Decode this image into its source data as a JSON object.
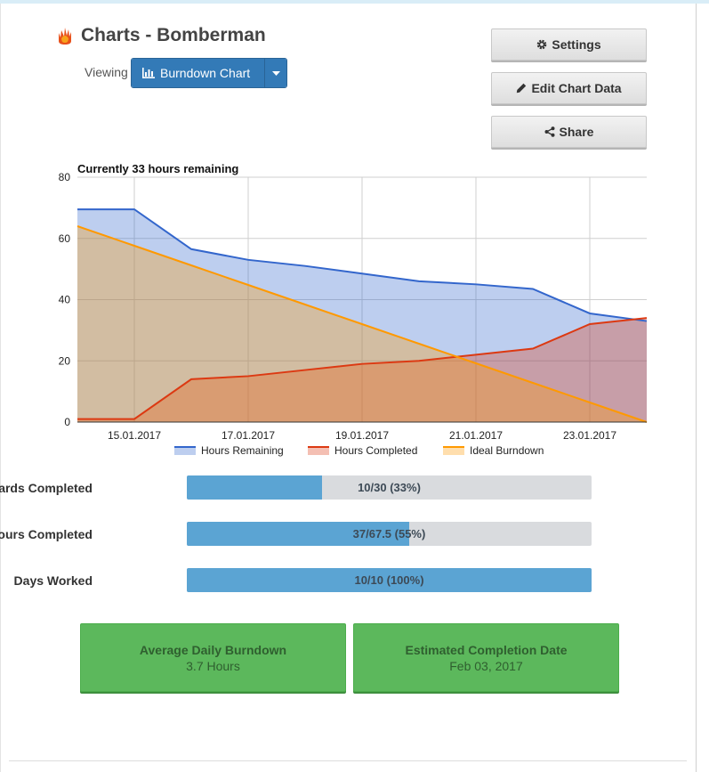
{
  "header": {
    "title": "Charts - Bomberman",
    "viewing_label": "Viewing",
    "view_selector": "Burndown Chart"
  },
  "actions": {
    "settings": "Settings",
    "edit": "Edit Chart Data",
    "share": "Share"
  },
  "colors": {
    "remaining": "#3366cc",
    "completed": "#dc3912",
    "ideal": "#ff9900",
    "progress": "#5ba4d3",
    "stat": "#5cb85c"
  },
  "chart_data": {
    "type": "area",
    "title": "Currently 33 hours remaining",
    "x": [
      "14.01.2017",
      "15.01.2017",
      "16.01.2017",
      "17.01.2017",
      "18.01.2017",
      "19.01.2017",
      "20.01.2017",
      "21.01.2017",
      "22.01.2017",
      "23.01.2017",
      "24.01.2017"
    ],
    "x_tick_labels": [
      "15.01.2017",
      "17.01.2017",
      "19.01.2017",
      "21.01.2017",
      "23.01.2017"
    ],
    "ylim": [
      0,
      80
    ],
    "y_ticks": [
      0,
      20,
      40,
      60,
      80
    ],
    "grid": true,
    "legend_position": "bottom",
    "series": [
      {
        "name": "Hours Remaining",
        "values": [
          69.5,
          69.5,
          56.5,
          53,
          51,
          48.5,
          46,
          45,
          43.5,
          35.5,
          33
        ]
      },
      {
        "name": "Hours Completed",
        "values": [
          1,
          1,
          14,
          15,
          17,
          19,
          20,
          22,
          24,
          32,
          34
        ]
      },
      {
        "name": "Ideal Burndown",
        "values": [
          64,
          57.6,
          51.2,
          44.8,
          38.4,
          32,
          25.6,
          19.2,
          12.8,
          6.4,
          0
        ]
      }
    ]
  },
  "progress": [
    {
      "label": "Cards Completed",
      "text": "10/30 (33%)",
      "fraction": 0.333
    },
    {
      "label": "Hours Completed",
      "text": "37/67.5 (55%)",
      "fraction": 0.55
    },
    {
      "label": "Days Worked",
      "text": "10/10 (100%)",
      "fraction": 1.0
    }
  ],
  "stats": [
    {
      "title": "Average Daily Burndown",
      "value": "3.7 Hours"
    },
    {
      "title": "Estimated Completion Date",
      "value": "Feb 03, 2017"
    }
  ]
}
